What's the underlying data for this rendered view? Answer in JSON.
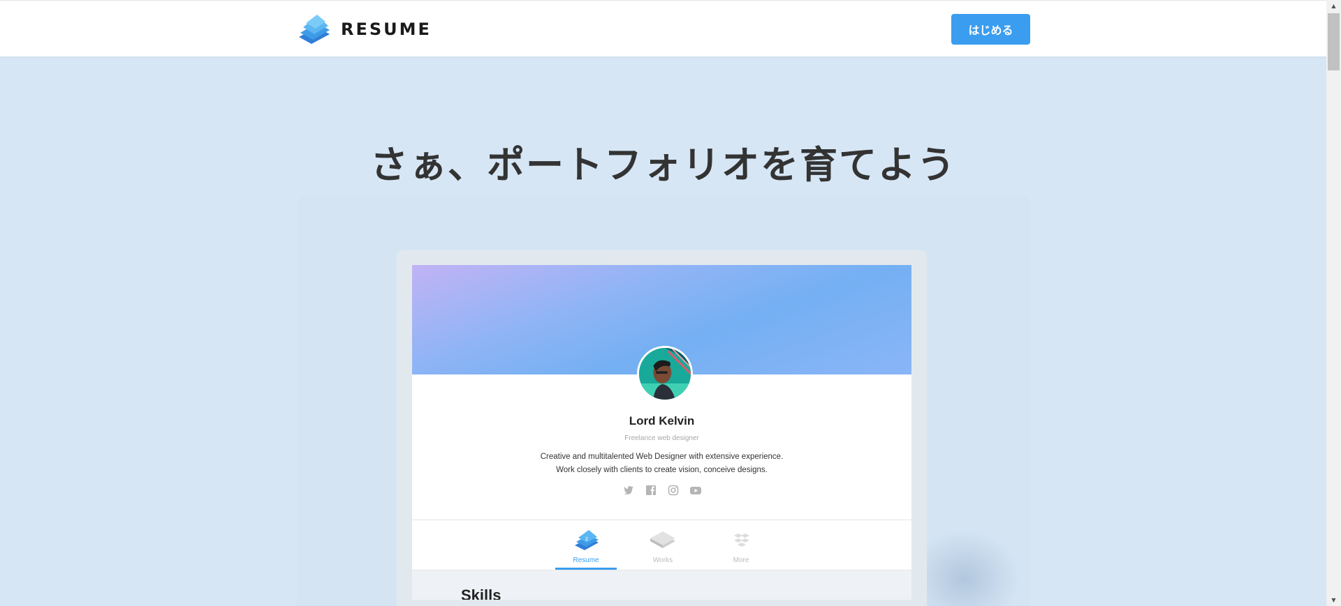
{
  "header": {
    "logo_text": "RESUME",
    "start_button": "はじめる"
  },
  "hero": {
    "headline": "さぁ、ポートフォリオを育てよう"
  },
  "preview": {
    "name": "Lord Kelvin",
    "role": "Freelance web designer",
    "bio_line1": "Creative and multitalented Web Designer with extensive experience.",
    "bio_line2": "Work closely with clients to create vision, conceive designs.",
    "social_icons": [
      "twitter-icon",
      "facebook-icon",
      "instagram-icon",
      "youtube-icon"
    ],
    "tabs": [
      {
        "label": "Resume",
        "active": true
      },
      {
        "label": "Works",
        "active": false
      },
      {
        "label": "More",
        "active": false
      }
    ],
    "section_title": "Skills"
  },
  "colors": {
    "accent": "#3a9df0",
    "page_bg": "#d6e6f5",
    "heading": "#333333"
  }
}
